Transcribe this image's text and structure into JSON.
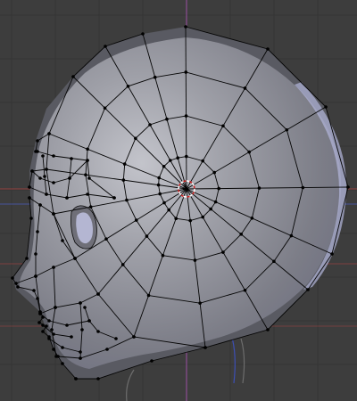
{
  "viewport": {
    "background": "#3d3d3d",
    "grid_color": "#353535",
    "x_axis_color": "#a8423f",
    "z_axis_color": "#9b4fa3",
    "y_axis_color": "#4b5ec4",
    "mesh_fill": "#9a9ba3",
    "mesh_rim_color": "#aeb0cf",
    "wire_color": "#050505",
    "vertex_color": "#000000",
    "pivot_colors": [
      "#ffffff",
      "#d02020"
    ]
  }
}
